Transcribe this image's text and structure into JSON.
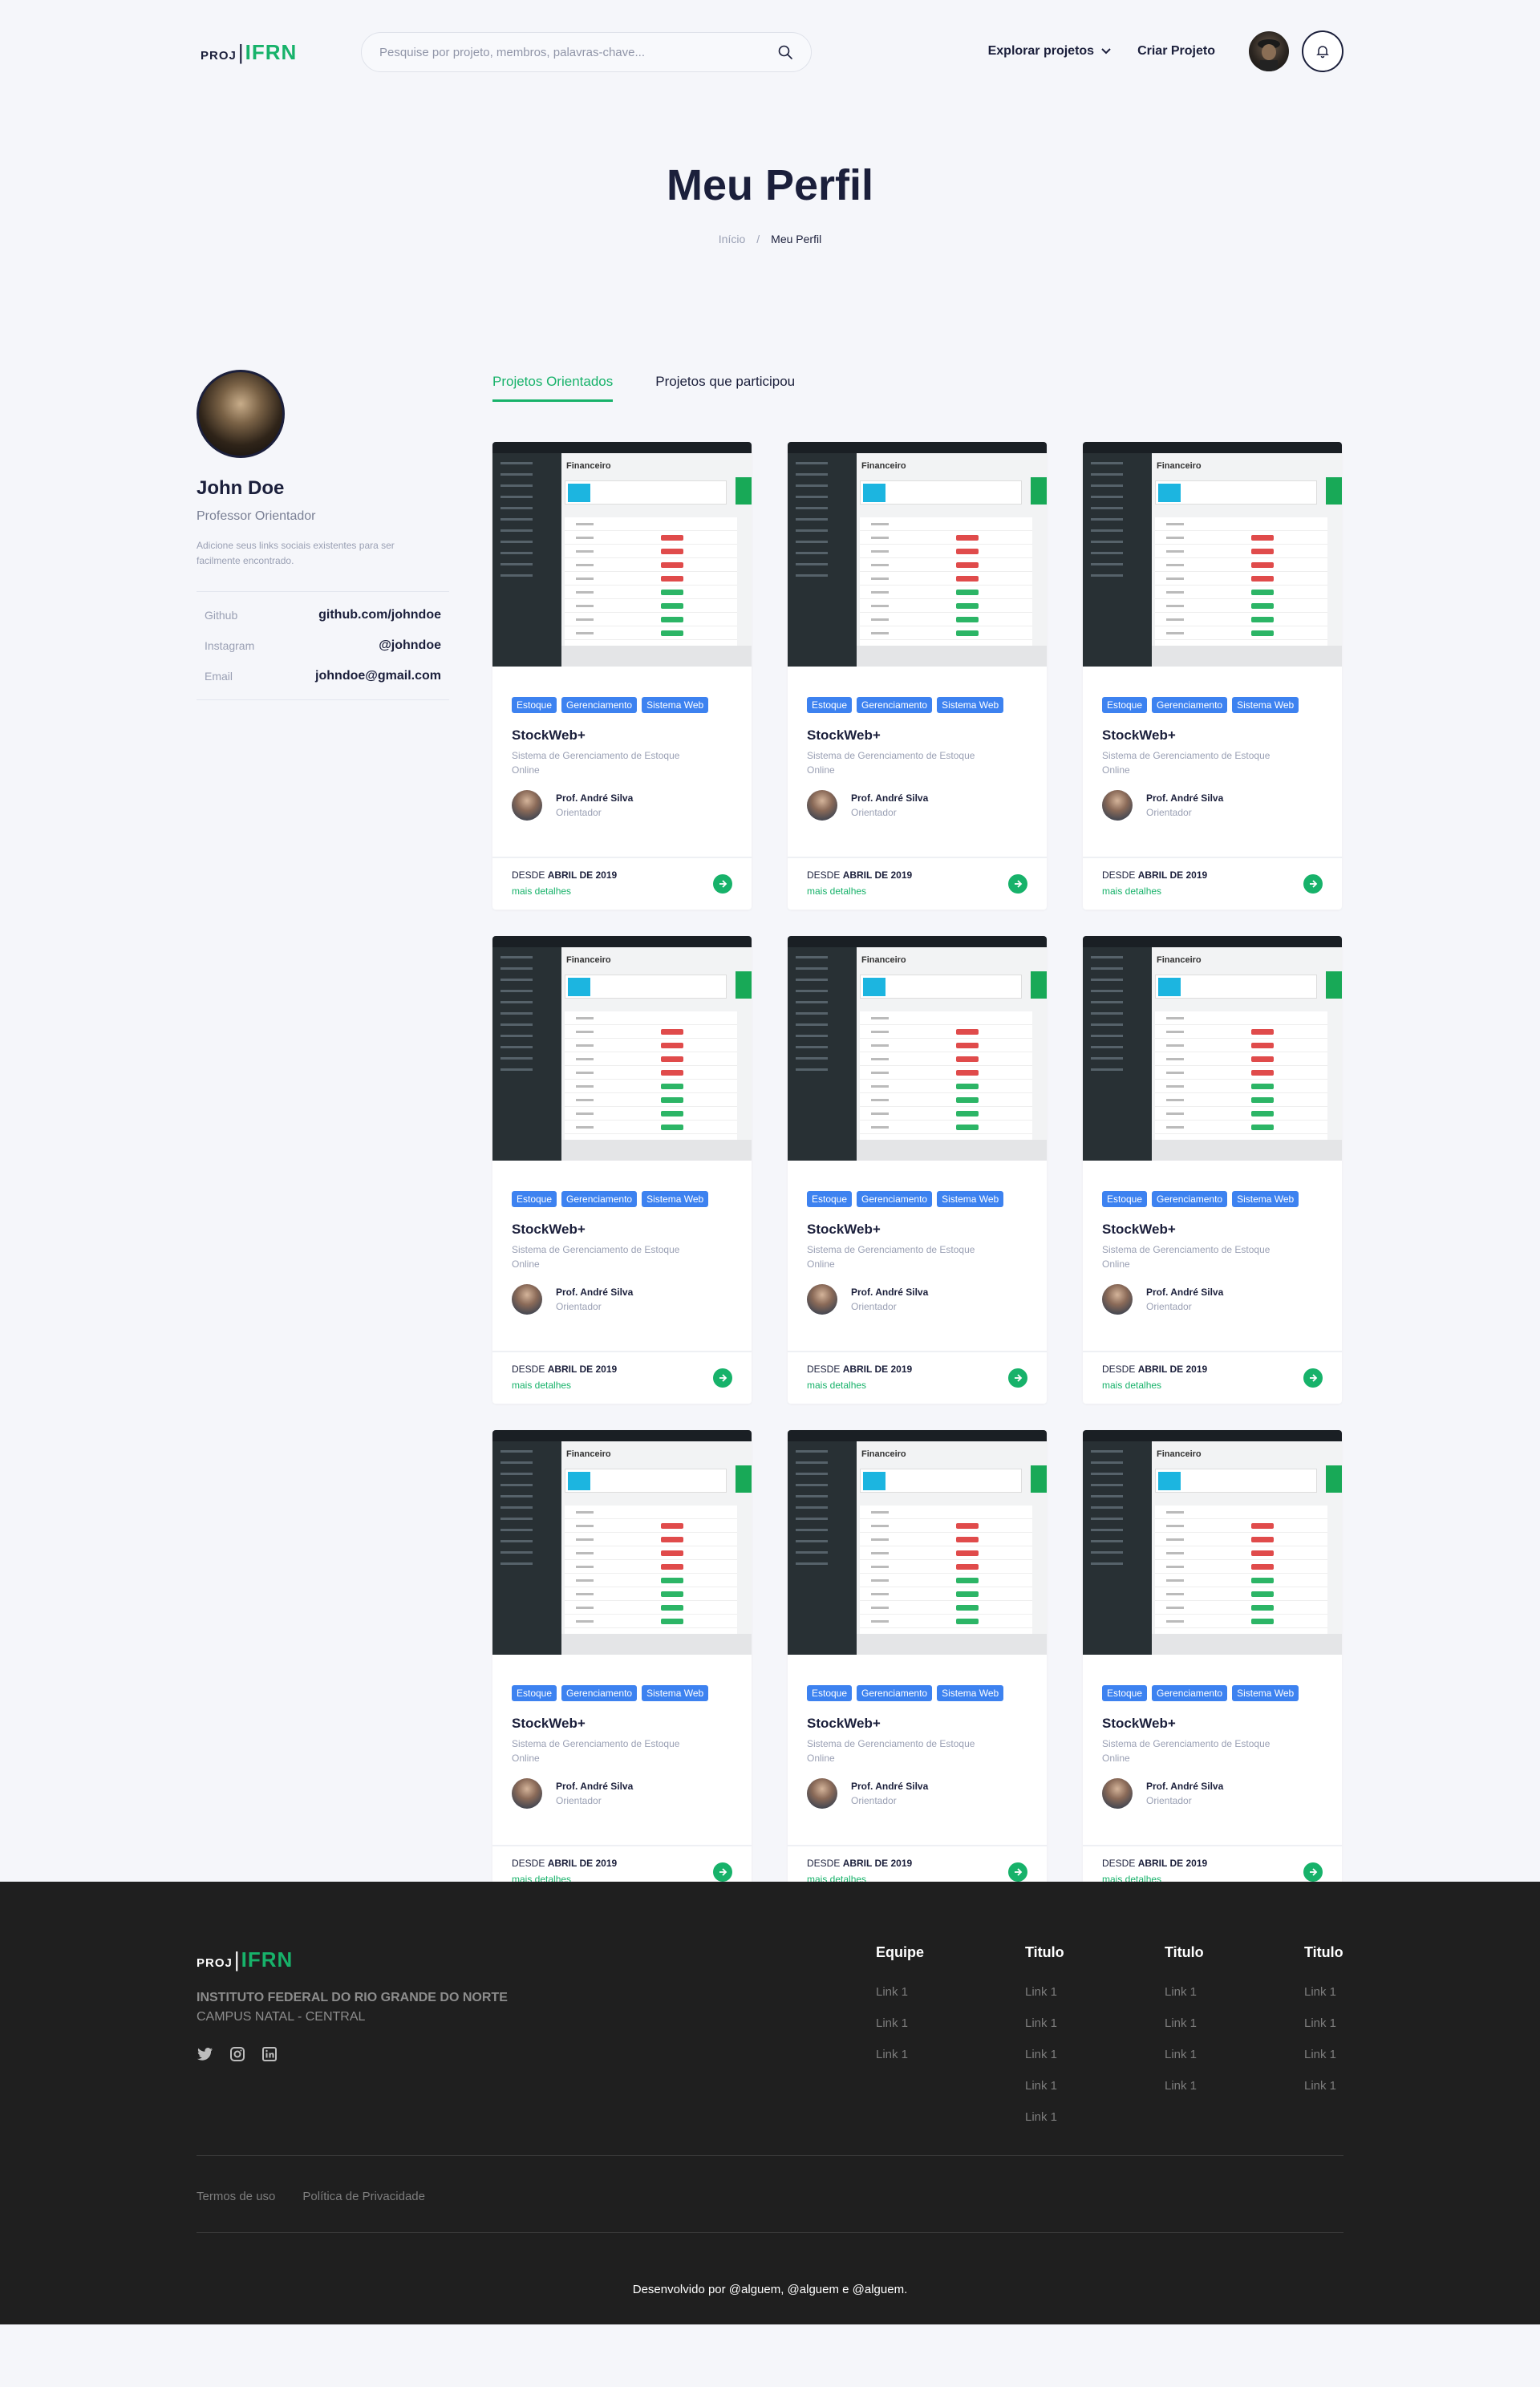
{
  "header": {
    "logo_prefix": "PROJ",
    "logo_sep": "|",
    "logo_brand": "IFRN",
    "search_placeholder": "Pesquise por projeto, membros, palavras-chave...",
    "nav_explore": "Explorar projetos",
    "nav_create": "Criar Projeto"
  },
  "page": {
    "title": "Meu Perfil",
    "breadcrumb_home": "Início",
    "breadcrumb_sep": "/",
    "breadcrumb_current": "Meu Perfil"
  },
  "profile": {
    "name": "John Doe",
    "role": "Professor Orientador",
    "description": "Adicione seus links sociais existentes para ser facilmente encontrado.",
    "links": [
      {
        "label": "Github",
        "value": "github.com/johndoe"
      },
      {
        "label": "Instagram",
        "value": "@johndoe"
      },
      {
        "label": "Email",
        "value": "johndoe@gmail.com"
      }
    ]
  },
  "tabs": [
    {
      "label": "Projetos Orientados",
      "active": true
    },
    {
      "label": "Projetos que participou",
      "active": false
    }
  ],
  "card_template": {
    "thumb_title": "Financeiro",
    "tags": [
      "Estoque",
      "Gerenciamento",
      "Sistema Web"
    ],
    "title": "StockWeb+",
    "description": "Sistema de Gerenciamento de Estoque Online",
    "author_name": "Prof. André Silva",
    "author_role": "Orientador",
    "since_prefix": "DESDE",
    "since_date": "ABRIL DE 2019",
    "more": "mais detalhes"
  },
  "card_count": 9,
  "footer": {
    "logo_prefix": "PROJ",
    "logo_sep": "|",
    "logo_brand": "IFRN",
    "institution": "INSTITUTO FEDERAL DO RIO GRANDE DO NORTE",
    "campus": "CAMPUS NATAL - CENTRAL",
    "columns": [
      {
        "title": "Equipe",
        "links": [
          "Link 1",
          "Link 1",
          "Link 1"
        ]
      },
      {
        "title": "Titulo",
        "links": [
          "Link 1",
          "Link 1",
          "Link 1",
          "Link 1",
          "Link 1"
        ]
      },
      {
        "title": "Titulo",
        "links": [
          "Link 1",
          "Link 1",
          "Link 1",
          "Link 1"
        ]
      },
      {
        "title": "Titulo",
        "links": [
          "Link 1",
          "Link 1",
          "Link 1",
          "Link 1"
        ]
      }
    ],
    "terms": "Termos de uso",
    "privacy": "Política de Privacidade",
    "copyright": "Desenvolvido por @alguem, @alguem e @alguem."
  },
  "colors": {
    "accent_green": "#17b26a",
    "tag_blue": "#3d82f0",
    "dark_text": "#1b1f3b",
    "footer_bg": "#1f1f1f"
  }
}
